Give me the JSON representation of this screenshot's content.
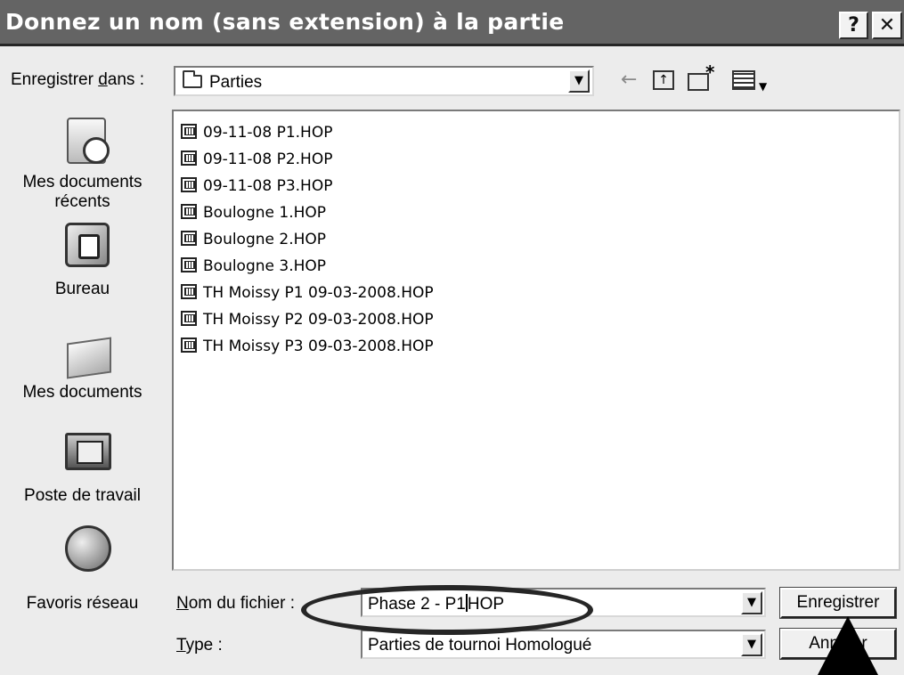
{
  "window": {
    "title": "Donnez un nom (sans extension) à la partie",
    "help_glyph": "?",
    "close_glyph": "✕"
  },
  "save_in": {
    "label": "Enregistrer dans :",
    "value": "Parties"
  },
  "toolbar": {
    "back_icon": "back-arrow-icon",
    "up_icon": "up-folder-icon",
    "new_folder_icon": "new-folder-icon",
    "views_icon": "views-menu-icon"
  },
  "places": [
    {
      "label_line1": "Mes documents",
      "label_line2": "récents",
      "icon": "recent-documents-icon"
    },
    {
      "label_line1": "Bureau",
      "label_line2": "",
      "icon": "desktop-icon"
    },
    {
      "label_line1": "Mes documents",
      "label_line2": "",
      "icon": "my-documents-icon"
    },
    {
      "label_line1": "Poste de travail",
      "label_line2": "",
      "icon": "my-computer-icon"
    },
    {
      "label_line1": "Favoris réseau",
      "label_line2": "",
      "icon": "network-places-icon"
    }
  ],
  "files": [
    "09-11-08 P1.HOP",
    "09-11-08 P2.HOP",
    "09-11-08 P3.HOP",
    "Boulogne 1.HOP",
    "Boulogne 2.HOP",
    "Boulogne 3.HOP",
    "TH Moissy P1 09-03-2008.HOP",
    "TH Moissy P2 09-03-2008.HOP",
    "TH Moissy P3 09-03-2008.HOP"
  ],
  "filename": {
    "label": "Nom du fichier :",
    "value_before_caret": "Phase 2 - P1",
    "value_after_caret": "HOP"
  },
  "filetype": {
    "label": "Type :",
    "value": "Parties de tournoi Homologué"
  },
  "buttons": {
    "save": "Enregistrer",
    "cancel": "Annuler"
  }
}
